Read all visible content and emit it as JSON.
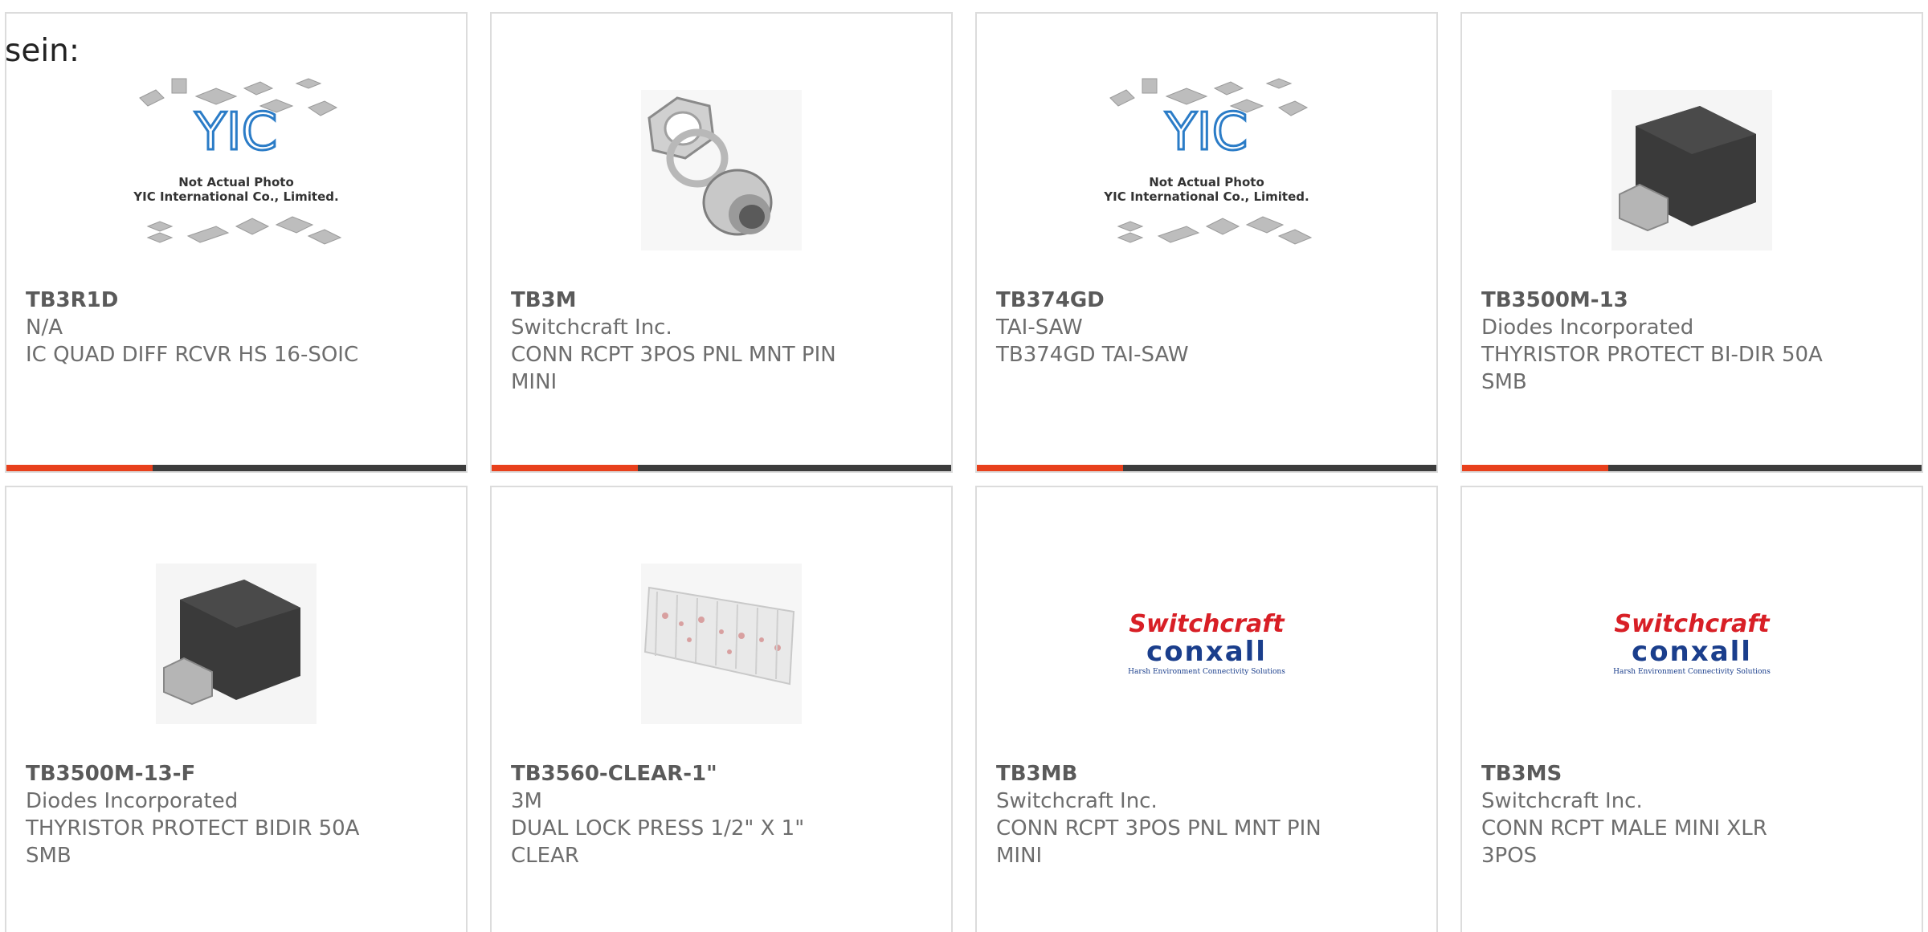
{
  "heading": "sein:",
  "colors": {
    "accent_red": "#e8401c",
    "accent_dark": "#3c3c3c",
    "switchcraft_red": "#d81f26",
    "conxall_blue": "#1a3e8c",
    "yic_blue": "#2b7cc7"
  },
  "yic_placeholder": {
    "line1": "Not Actual Photo",
    "line2": "YIC International Co., Limited.",
    "logo": "YIC"
  },
  "switchcraft_logo": {
    "brand": "Switchcraft",
    "sub": "conxall",
    "tagline": "Harsh Environment Connectivity Solutions"
  },
  "products": [
    {
      "part": "TB3R1D",
      "mfr": "N/A",
      "desc": "IC QUAD DIFF RCVR HS 16-SOIC",
      "image": "yic-placeholder-image"
    },
    {
      "part": "TB3M",
      "mfr": "Switchcraft Inc.",
      "desc": "CONN RCPT 3POS PNL MNT PIN MINI",
      "image": "panel-connector-image"
    },
    {
      "part": "TB374GD",
      "mfr": "TAI-SAW",
      "desc": "TB374GD TAI-SAW",
      "image": "yic-placeholder-image"
    },
    {
      "part": "TB3500M-13",
      "mfr": "Diodes Incorporated",
      "desc": "THYRISTOR PROTECT BI-DIR 50A SMB",
      "image": "smb-package-image"
    },
    {
      "part": "TB3500M-13-F",
      "mfr": "Diodes Incorporated",
      "desc": "THYRISTOR PROTECT BIDIR 50A SMB",
      "image": "smb-package-image"
    },
    {
      "part": "TB3560-CLEAR-1\"",
      "mfr": "3M",
      "desc": "DUAL LOCK PRESS 1/2\" X 1\" CLEAR",
      "image": "dual-lock-strip-image"
    },
    {
      "part": "TB3MB",
      "mfr": "Switchcraft Inc.",
      "desc": "CONN RCPT 3POS PNL MNT PIN MINI",
      "image": "switchcraft-logo-image"
    },
    {
      "part": "TB3MS",
      "mfr": "Switchcraft Inc.",
      "desc": "CONN RCPT MALE MINI XLR 3POS",
      "image": "switchcraft-logo-image"
    }
  ]
}
